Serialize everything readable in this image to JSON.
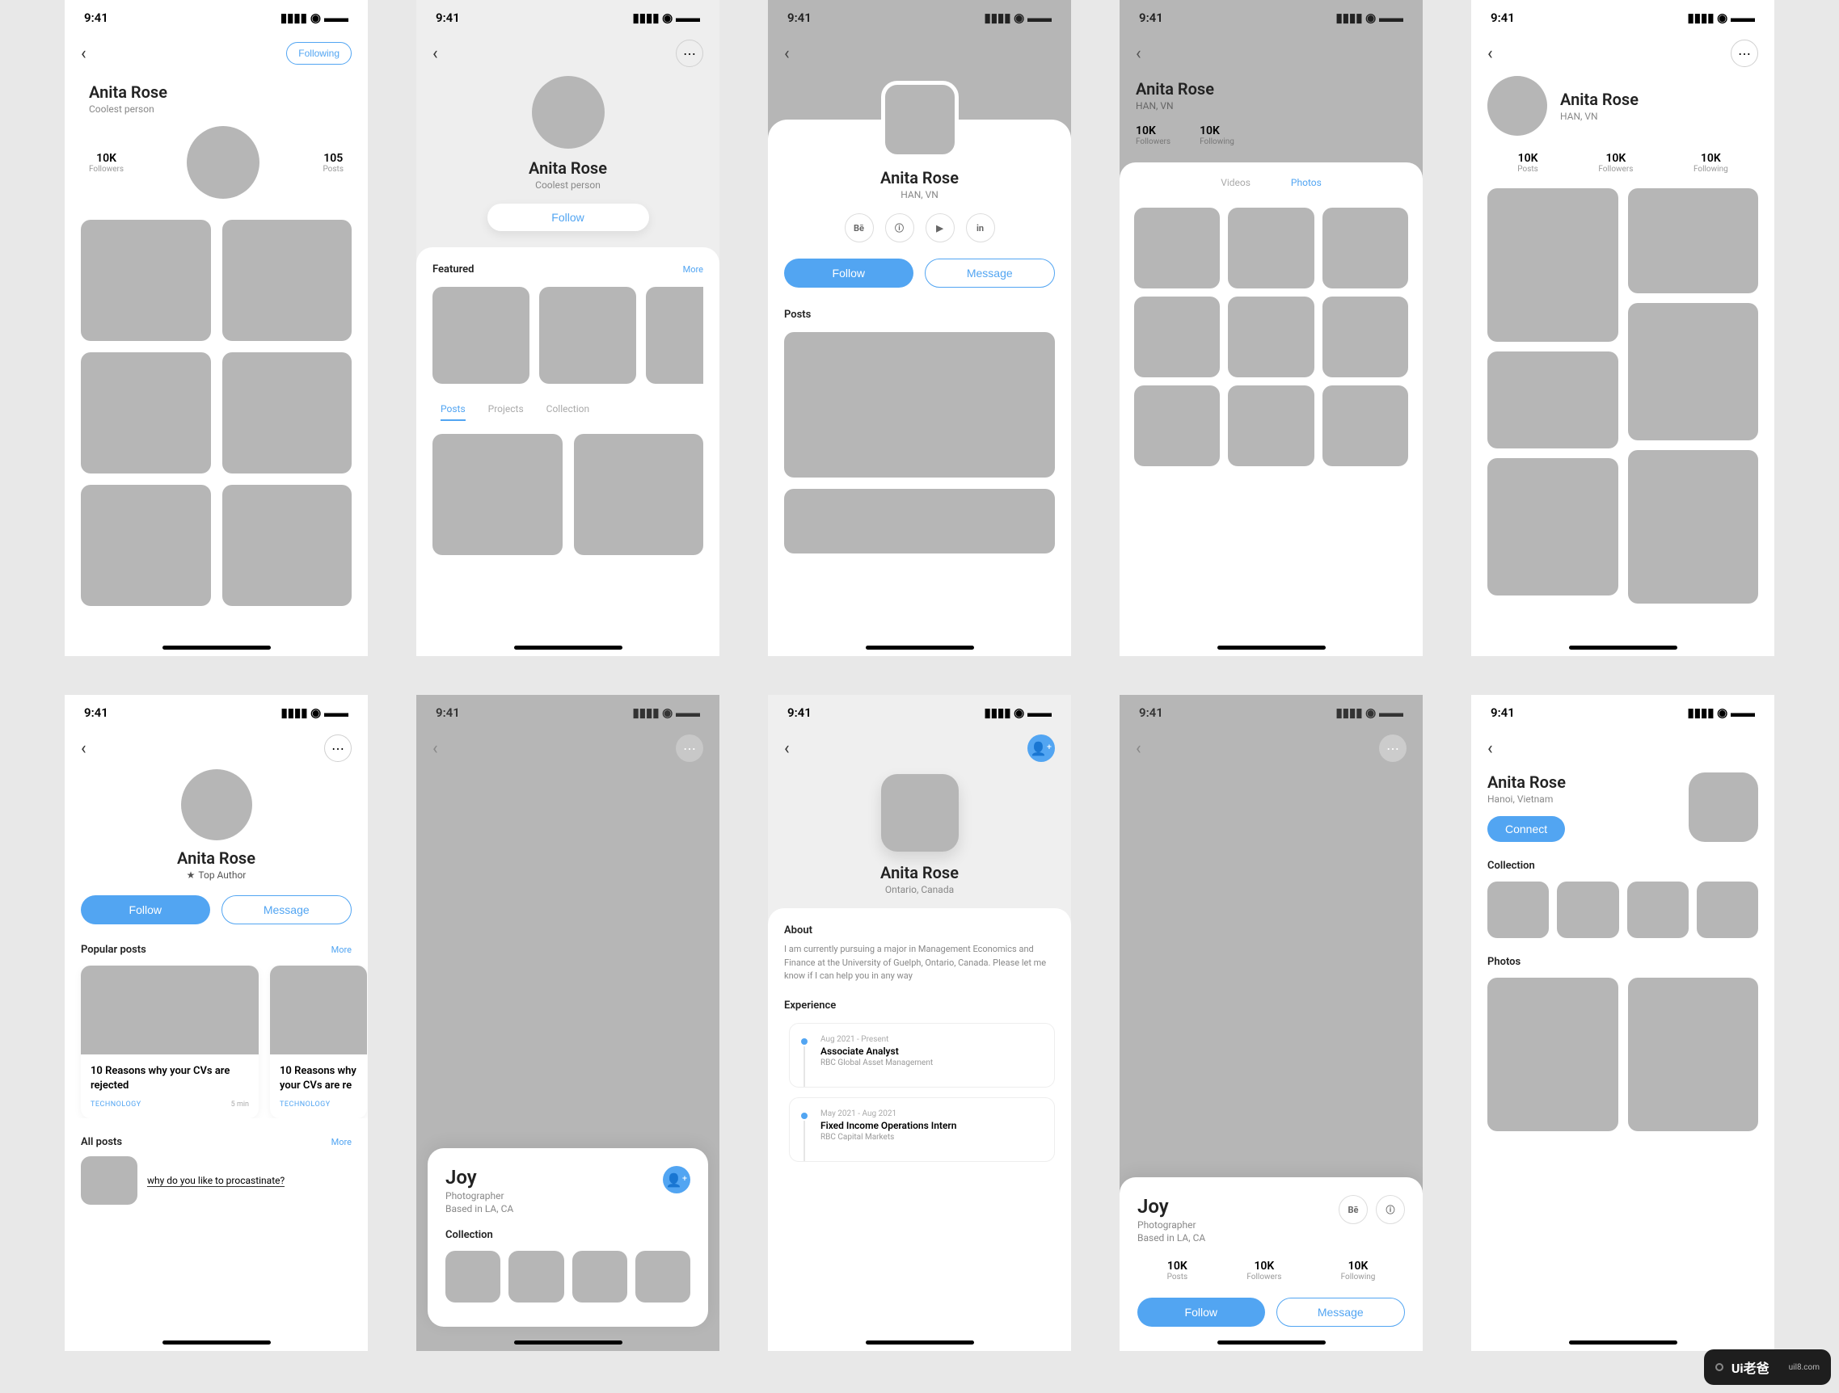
{
  "status": {
    "time": "9:41"
  },
  "watermark": {
    "brand": "Ui老爸",
    "url": "uil8.com"
  },
  "screen1": {
    "following_btn": "Following",
    "name": "Anita Rose",
    "subtitle": "Coolest person",
    "stat1": {
      "num": "10K",
      "lbl": "Followers"
    },
    "stat2": {
      "num": "105",
      "lbl": "Posts"
    }
  },
  "screen2": {
    "name": "Anita Rose",
    "subtitle": "Coolest person",
    "follow_btn": "Follow",
    "featured": "Featured",
    "more": "More",
    "tabs": {
      "t1": "Posts",
      "t2": "Projects",
      "t3": "Collection"
    }
  },
  "screen3": {
    "name": "Anita Rose",
    "subtitle": "HAN, VN",
    "social": {
      "a": "Bē",
      "b": "ⓘ",
      "c": "▶",
      "d": "in"
    },
    "follow_btn": "Follow",
    "message_btn": "Message",
    "posts": "Posts"
  },
  "screen4": {
    "name": "Anita Rose",
    "subtitle": "HAN, VN",
    "stat1": {
      "num": "10K",
      "lbl": "Followers"
    },
    "stat2": {
      "num": "10K",
      "lbl": "Following"
    },
    "tabs": {
      "t1": "Videos",
      "t2": "Photos"
    }
  },
  "screen5": {
    "name": "Anita Rose",
    "subtitle": "HAN, VN",
    "stat1": {
      "num": "10K",
      "lbl": "Posts"
    },
    "stat2": {
      "num": "10K",
      "lbl": "Followers"
    },
    "stat3": {
      "num": "10K",
      "lbl": "Following"
    }
  },
  "screen6": {
    "name": "Anita Rose",
    "badge": "Top Author",
    "follow_btn": "Follow",
    "message_btn": "Message",
    "popular": "Popular posts",
    "more": "More",
    "all": "All posts",
    "more2": "More",
    "post1": {
      "title": "10 Reasons why your CVs are rejected",
      "tag": "TECHNOLOGY",
      "rt": "5 min"
    },
    "post2": {
      "title": "10 Reasons why your CVs are re",
      "tag": "TECHNOLOGY",
      "rt": ""
    },
    "q": "why do you like to procastinate?"
  },
  "screen7": {
    "name": "Joy",
    "sub1": "Photographer",
    "sub2": "Based in LA, CA",
    "collection": "Collection"
  },
  "screen8": {
    "name": "Anita Rose",
    "subtitle": "Ontario, Canada",
    "about_label": "About",
    "about": "I am currently pursuing a major in Management Economics and Finance at the University of Guelph, Ontario, Canada. Please let me know if I can help you in any way",
    "exp": "Experience",
    "e1": {
      "date": "Aug 2021 - Present",
      "title": "Associate Analyst",
      "sub": "RBC Global Asset Management"
    },
    "e2": {
      "date": "May 2021 - Aug 2021",
      "title": "Fixed Income Operations Intern",
      "sub": "RBC Capital Markets"
    }
  },
  "screen9": {
    "name": "Joy",
    "sub1": "Photographer",
    "sub2": "Based in LA, CA",
    "social": {
      "a": "Bē",
      "b": "ⓘ"
    },
    "stat1": {
      "num": "10K",
      "lbl": "Posts"
    },
    "stat2": {
      "num": "10K",
      "lbl": "Followers"
    },
    "stat3": {
      "num": "10K",
      "lbl": "Following"
    },
    "follow_btn": "Follow",
    "message_btn": "Message"
  },
  "screen10": {
    "name": "Anita Rose",
    "subtitle": "Hanoi, Vietnam",
    "connect_btn": "Connect",
    "collection": "Collection",
    "photos": "Photos"
  }
}
